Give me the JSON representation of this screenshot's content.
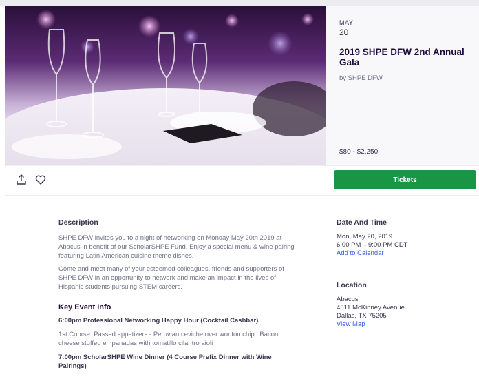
{
  "event": {
    "month": "MAY",
    "day": "20",
    "title": "2019 SHPE DFW 2nd Annual Gala",
    "organizer": "by SHPE DFW",
    "price": "$80 - $2,250"
  },
  "actions": {
    "share_icon": "share-icon",
    "like_icon": "heart-icon",
    "tickets_label": "Tickets",
    "accent": "#1a9546"
  },
  "description": {
    "heading": "Description",
    "paragraph1": "SHPE DFW invites you to a night of networking on Monday May 20th 2019 at Abacus in benefit of our ScholarSHPE Fund. Enjoy a special menu & wine pairing featuring Latin American cuisine theme dishes.",
    "paragraph2": "Come and meet many of your esteemed colleagues, friends and supporters of SHPE DFW in an opportunity to network and make an impact in the lives of Hispanic students pursuing STEM careers.",
    "key_heading": "Key Event Info",
    "item1": "6:00pm Professional Networking Happy Hour (Cocktail Cashbar)",
    "item1_detail": "1st Course: Passed appetizers - Peruvian ceviche over wonton chip | Bacon cheese stuffed empanadas with tomatillo cilantro aioli",
    "item2": "7:00pm ScholarSHPE Wine Dinner (4 Course Prefix Dinner with Wine Pairings)"
  },
  "date_time": {
    "heading": "Date And Time",
    "date": "Mon, May 20, 2019",
    "time": "6:00 PM – 9:00 PM CDT",
    "calendar_link": "Add to Calendar"
  },
  "location": {
    "heading": "Location",
    "venue": "Abacus",
    "street": "4511 McKinney Avenue",
    "city": "Dallas, TX 75205",
    "map_link": "View Map"
  }
}
